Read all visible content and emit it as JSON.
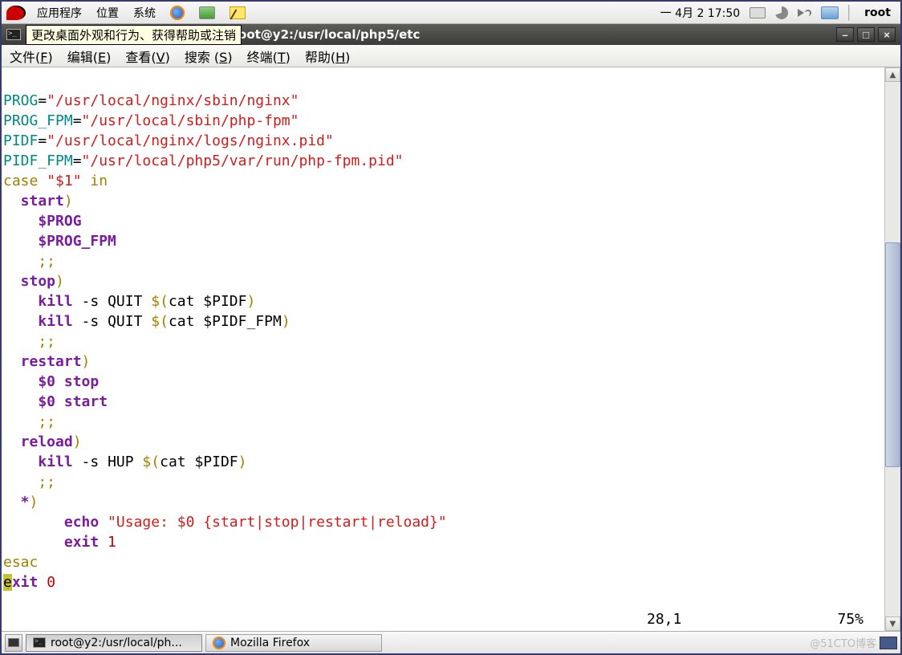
{
  "panel": {
    "menus": {
      "apps": "应用程序",
      "places": "位置",
      "system": "系统"
    },
    "clock": "一  4月  2 17:50",
    "user": "root",
    "system_tooltip": "更改桌面外观和行为、获得帮助或注销"
  },
  "window": {
    "title": "oot@y2:/usr/local/php5/etc",
    "full_title": "root@y2:/usr/local/php5/etc"
  },
  "menubar": {
    "file": "文件",
    "file_u": "F",
    "edit": "编辑",
    "edit_u": "E",
    "view": "查看",
    "view_u": "V",
    "search": "搜索 ",
    "search_u": "S",
    "terminal": "终端",
    "terminal_u": "T",
    "help": "帮助",
    "help_u": "H"
  },
  "code": {
    "l1_var": "PROG",
    "l1_eq": "=",
    "l1_val": "\"/usr/local/nginx/sbin/nginx\"",
    "l2_var": "PROG_FPM",
    "l2_eq": "=",
    "l2_val": "\"/usr/local/sbin/php-fpm\"",
    "l3_var": "PIDF",
    "l3_eq": "=",
    "l3_val": "\"/usr/local/nginx/logs/nginx.pid\"",
    "l4_var": "PIDF_FPM",
    "l4_eq": "=",
    "l4_val": "\"/usr/local/php5/var/run/php-fpm.pid\"",
    "l5_case": "case ",
    "l5_arg": "\"$1\"",
    "l5_in": " in",
    "l6": "  start",
    "l6_p": ")",
    "l7": "    $PROG",
    "l8": "    $PROG_FPM",
    "l9": "    ;;",
    "l10": "  stop",
    "l10_p": ")",
    "l11a": "    ",
    "l11_kill": "kill",
    "l11b": " -s QUIT ",
    "l11_sub": "$(",
    "l11_cat": "cat $PIDF",
    "l11_sub2": ")",
    "l12a": "    ",
    "l12_kill": "kill",
    "l12b": " -s QUIT ",
    "l12_sub": "$(",
    "l12_cat": "cat $PIDF_FPM",
    "l12_sub2": ")",
    "l13": "    ;;",
    "l14": "  restart",
    "l14_p": ")",
    "l15": "    $0 stop",
    "l16": "    $0 start",
    "l17": "    ;;",
    "l18": "  reload",
    "l18_p": ")",
    "l19a": "    ",
    "l19_kill": "kill",
    "l19b": " -s HUP ",
    "l19_sub": "$(",
    "l19_cat": "cat $PIDF",
    "l19_sub2": ")",
    "l20": "    ;;",
    "l21": "  *",
    "l21_p": ")",
    "l22a": "       ",
    "l22_echo": "echo ",
    "l22_q1": "\"",
    "l22_msg": "Usage: $0 {start|stop|restart|reload}",
    "l22_q2": "\"",
    "l23a": "       ",
    "l23_exit": "exit ",
    "l23_n": "1",
    "l24": "esac",
    "l25_e": "e",
    "l25_rest": "xit ",
    "l25_n": "0"
  },
  "status": {
    "pos": "28,1",
    "pct": "75%"
  },
  "taskbar": {
    "t1": "root@y2:/usr/local/ph...",
    "t2": "Mozilla Firefox",
    "watermark": "@51CTO博客"
  }
}
